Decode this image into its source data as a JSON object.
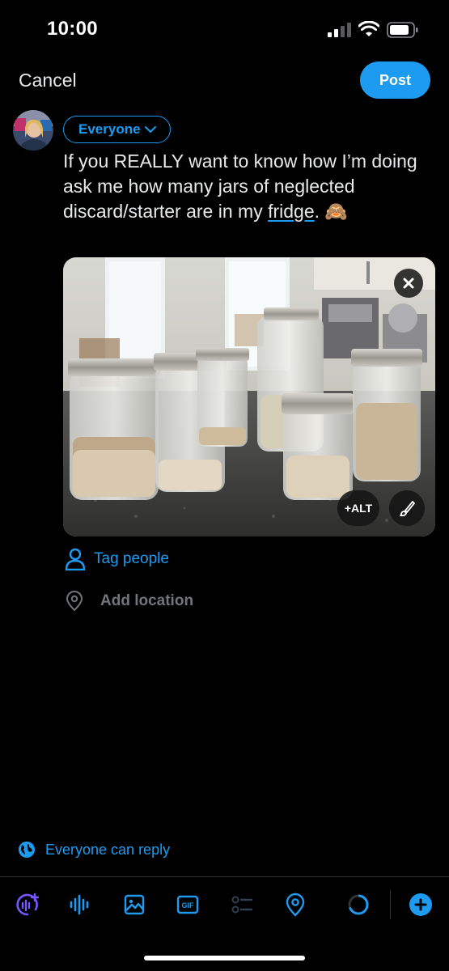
{
  "status_bar": {
    "time": "10:00"
  },
  "header": {
    "cancel_label": "Cancel",
    "post_label": "Post"
  },
  "composer": {
    "audience_label": "Everyone",
    "text_part1": "If you REALLY want to know how I’m doing ask me how many jars of neglected discard/starter are in my ",
    "text_link": "fridge",
    "text_part2": ". 🙈"
  },
  "media": {
    "alt_label": "+ALT"
  },
  "actions": {
    "tag_people": "Tag people",
    "add_location": "Add location"
  },
  "reply_setting": {
    "label": "Everyone can reply"
  },
  "colors": {
    "accent": "#1d9bf0",
    "background": "#000000",
    "muted": "#71767b",
    "grok": "#7856ff"
  },
  "toolbar_icons": [
    "grok-voice-icon",
    "audio-waveform-icon",
    "image-icon",
    "gif-icon",
    "poll-icon",
    "location-pin-icon",
    "character-count-ring-icon",
    "add-post-icon"
  ]
}
